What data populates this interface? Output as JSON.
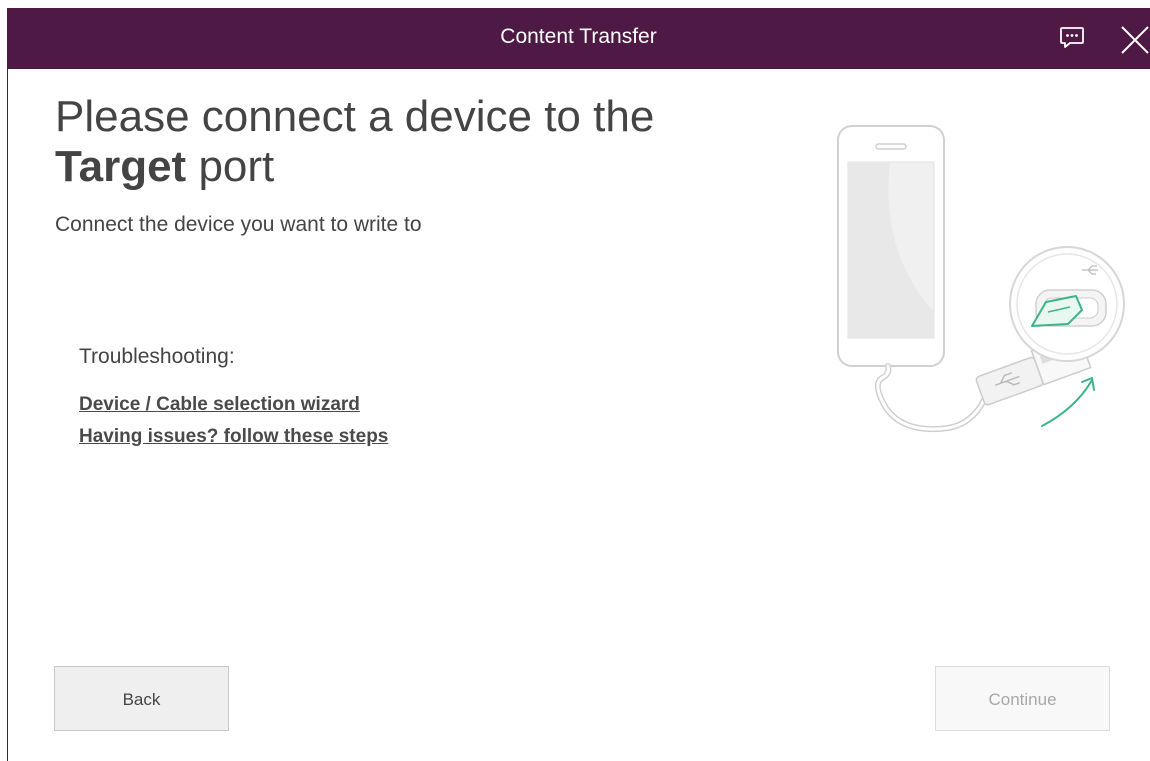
{
  "window": {
    "title": "Content Transfer",
    "feedback_icon": "feedback-icon",
    "close_icon": "close-icon"
  },
  "main": {
    "heading_line1": "Please connect a device to the",
    "heading_bold": "Target",
    "heading_rest": " port",
    "subheading": "Connect the device you want to write to",
    "troubleshooting_label": "Troubleshooting:",
    "links": [
      "Device / Cable selection wizard",
      "Having issues? follow these steps"
    ],
    "illustration_icon": "phone-usb-illustration"
  },
  "footer": {
    "back_label": "Back",
    "continue_label": "Continue",
    "continue_enabled": false
  },
  "colors": {
    "titlebar": "#4e1a45",
    "accent_green": "#3cb38a"
  }
}
